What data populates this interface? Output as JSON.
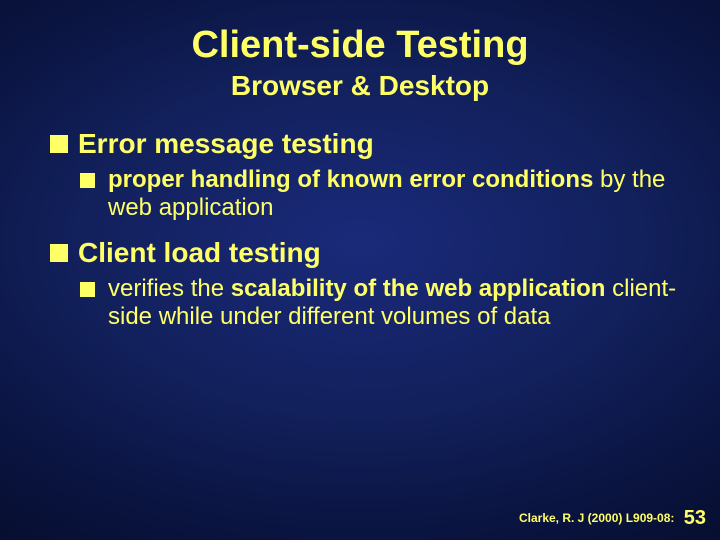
{
  "title": "Client-side Testing",
  "subtitle": "Browser & Desktop",
  "items": [
    {
      "heading": "Error message testing",
      "sub_pre_bold": "proper handling of known error conditions",
      "sub_rest": " by the web application"
    },
    {
      "heading": "Client load testing",
      "sub_pre": "verifies the ",
      "sub_bold": "scalability of the web application",
      "sub_rest": " client-side while under different volumes of data"
    }
  ],
  "footer": {
    "citation": "Clarke, R. J (2000) L909-08:",
    "page": "53"
  }
}
